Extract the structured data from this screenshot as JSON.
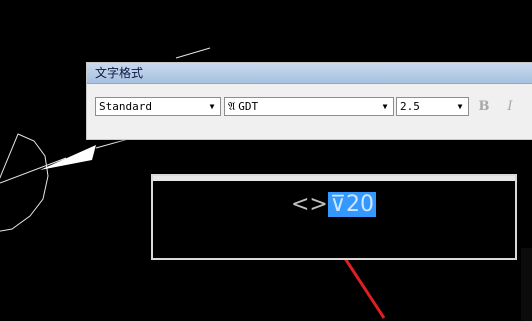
{
  "toolbar": {
    "title": "文字格式",
    "style_value": "Standard",
    "font_icon": "font-icon",
    "font_value": "GDT",
    "height_value": "2.5",
    "bold_label": "B",
    "italic_label": "I"
  },
  "editor": {
    "placeholder_text": "<>",
    "selected_text": "⊽20"
  },
  "colors": {
    "selection": "#3399ff",
    "annotation_arrow": "#e02020"
  }
}
